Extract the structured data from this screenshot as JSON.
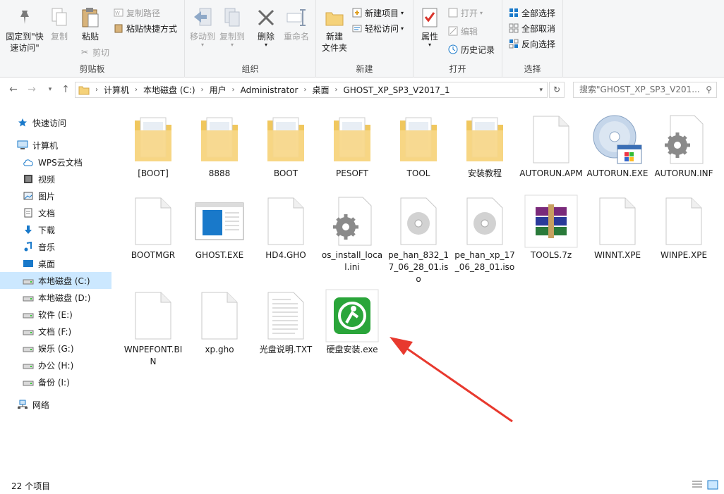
{
  "ribbon": {
    "clipboard": {
      "label": "剪贴板",
      "pin": "固定到\"快速访问\"",
      "copy": "复制",
      "paste": "粘贴",
      "copy_path": "复制路径",
      "paste_shortcut": "粘贴快捷方式",
      "cut": "剪切"
    },
    "organize": {
      "label": "组织",
      "move_to": "移动到",
      "copy_to": "复制到",
      "delete": "删除",
      "rename": "重命名"
    },
    "new": {
      "label": "新建",
      "new_folder": "新建\n文件夹",
      "new_item": "新建项目",
      "easy_access": "轻松访问"
    },
    "open": {
      "label": "打开",
      "properties": "属性",
      "open": "打开",
      "edit": "编辑",
      "history": "历史记录"
    },
    "select": {
      "label": "选择",
      "select_all": "全部选择",
      "select_none": "全部取消",
      "invert": "反向选择"
    }
  },
  "address": {
    "crumbs": [
      "计算机",
      "本地磁盘 (C:)",
      "用户",
      "Administrator",
      "桌面",
      "GHOST_XP_SP3_V2017_1"
    ],
    "search_placeholder": "搜索\"GHOST_XP_SP3_V201..."
  },
  "nav": {
    "items": [
      {
        "label": "快速访问",
        "icon": "star-icon"
      },
      {
        "label": "计算机",
        "icon": "computer-icon"
      },
      {
        "label": "WPS云文档",
        "icon": "cloud-icon"
      },
      {
        "label": "视频",
        "icon": "video-icon"
      },
      {
        "label": "图片",
        "icon": "picture-icon"
      },
      {
        "label": "文档",
        "icon": "document-icon"
      },
      {
        "label": "下载",
        "icon": "download-icon"
      },
      {
        "label": "音乐",
        "icon": "music-icon"
      },
      {
        "label": "桌面",
        "icon": "desktop-icon"
      },
      {
        "label": "本地磁盘 (C:)",
        "icon": "drive-icon"
      },
      {
        "label": "本地磁盘 (D:)",
        "icon": "drive-icon"
      },
      {
        "label": "软件 (E:)",
        "icon": "drive-icon"
      },
      {
        "label": "文档 (F:)",
        "icon": "drive-icon"
      },
      {
        "label": "娱乐 (G:)",
        "icon": "drive-icon"
      },
      {
        "label": "办公 (H:)",
        "icon": "drive-icon"
      },
      {
        "label": "备份 (I:)",
        "icon": "drive-icon"
      },
      {
        "label": "网络",
        "icon": "network-icon"
      }
    ]
  },
  "files": [
    {
      "name": "[BOOT]",
      "type": "folder"
    },
    {
      "name": "8888",
      "type": "folder"
    },
    {
      "name": "BOOT",
      "type": "folder"
    },
    {
      "name": "PESOFT",
      "type": "folder"
    },
    {
      "name": "TOOL",
      "type": "folder"
    },
    {
      "name": "安装教程",
      "type": "folder"
    },
    {
      "name": "AUTORUN.APM",
      "type": "file"
    },
    {
      "name": "AUTORUN.EXE",
      "type": "cd-exe"
    },
    {
      "name": "AUTORUN.INF",
      "type": "config"
    },
    {
      "name": "BOOTMGR",
      "type": "file"
    },
    {
      "name": "GHOST.EXE",
      "type": "window-exe"
    },
    {
      "name": "HD4.GHO",
      "type": "file"
    },
    {
      "name": "os_install_local.ini",
      "type": "config"
    },
    {
      "name": "pe_han_832_17_06_28_01.iso",
      "type": "iso"
    },
    {
      "name": "pe_han_xp_17_06_28_01.iso",
      "type": "iso"
    },
    {
      "name": "TOOLS.7z",
      "type": "rar"
    },
    {
      "name": "WINNT.XPE",
      "type": "file"
    },
    {
      "name": "WINPE.XPE",
      "type": "file"
    },
    {
      "name": "WNPEFONT.BIN",
      "type": "file"
    },
    {
      "name": "xp.gho",
      "type": "file"
    },
    {
      "name": "光盘说明.TXT",
      "type": "text"
    },
    {
      "name": "硬盘安装.exe",
      "type": "green-exe"
    }
  ],
  "status": {
    "count": "22 个项目"
  },
  "colors": {
    "accent": "#1979ca",
    "selected": "#cce8ff",
    "arrow": "#e8392e",
    "folder": "#f5d27a"
  }
}
